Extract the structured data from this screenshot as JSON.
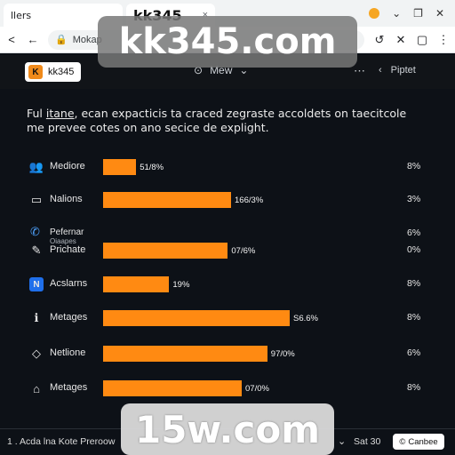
{
  "browser": {
    "tab1_title": "llers",
    "tab2_title": "kk345",
    "tab_close": "×",
    "win_min": "⌄",
    "win_restore": "❐",
    "win_close": "✕",
    "back": "<",
    "forward": "←",
    "address": "Mokap",
    "toolbar_icons": [
      "↺",
      "✕",
      "▢",
      "⋮"
    ]
  },
  "app": {
    "brand_badge": "K",
    "brand_name": "kk345",
    "menu_label": "Mew",
    "menu_caret": "⌄",
    "dots": "⋯",
    "right_chevron": "‹",
    "right_label": "Piptet"
  },
  "description": {
    "part1": "Ful ",
    "link": "itane",
    "part2": ", ecan expacticis ta craced zegraste accoldets on taecitcole me prevee cotes on ano secice de explight."
  },
  "rows": [
    {
      "icon": "users-icon",
      "glyph": "👥",
      "label": "Mediore",
      "value_text": "51/8%",
      "fraction": 0.155,
      "pct": "8%"
    },
    {
      "icon": "monitor-icon",
      "glyph": "▭",
      "label": "Nalions",
      "value_text": "166/3%",
      "fraction": 0.6,
      "pct": "3%"
    },
    {
      "icon": "edit-icon",
      "glyph": "✎",
      "label": "Prichate",
      "value_text": "07/6%",
      "fraction": 0.585,
      "pct": "0%"
    },
    {
      "icon": "n-box-icon",
      "glyph": "N",
      "label": "Acslarns",
      "value_text": "19%",
      "fraction": 0.31,
      "pct": "8%"
    },
    {
      "icon": "info-icon",
      "glyph": "ℹ",
      "label": "Metages",
      "value_text": "S6.6%",
      "fraction": 0.875,
      "pct": "8%"
    },
    {
      "icon": "tag-icon",
      "glyph": "◇",
      "label": "Netlione",
      "value_text": "97/0%",
      "fraction": 0.77,
      "pct": "6%"
    },
    {
      "icon": "briefcase-icon",
      "glyph": "⌂",
      "label": "Metages",
      "value_text": "07/0%",
      "fraction": 0.65,
      "pct": "8%"
    }
  ],
  "extra_row": {
    "label": "Pefernar",
    "sublabel": "Oiaapes",
    "pct": "6%"
  },
  "watermarks": {
    "top": "kk345.com",
    "bottom": "15w.com"
  },
  "footer": {
    "left_text": "1 . Acda lna Kote Preroow",
    "chevron": "⌄",
    "sat_text": "Sat 30",
    "button_icon": "©",
    "button_label": "Canbee"
  },
  "colors": {
    "bar": "#ff8a12",
    "background": "#0d1117",
    "brand_logo": "#f08a1a"
  }
}
